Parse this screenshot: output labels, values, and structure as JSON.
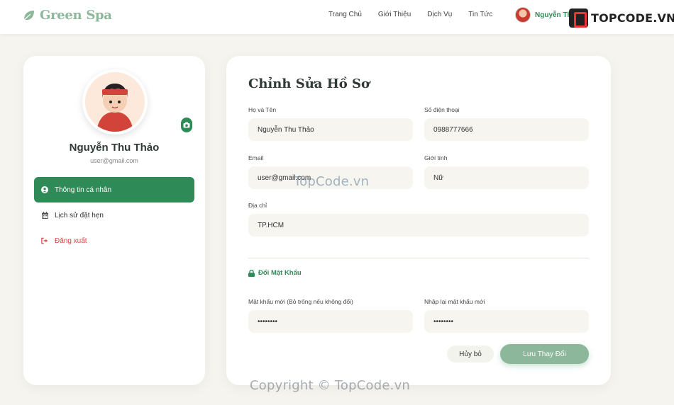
{
  "brand": {
    "name": "Green Spa",
    "leaf_color": "#8cb79a"
  },
  "nav": {
    "links": [
      "Trang Chủ",
      "Giới Thiệu",
      "Dịch Vụ",
      "Tin Tức"
    ],
    "user_name": "Nguyễn Th"
  },
  "topcode_badge": {
    "text": "TOPCODE.VN"
  },
  "profile": {
    "name": "Nguyễn Thu Thảo",
    "email": "user@gmail.com",
    "avatar_icon": "avatar-image",
    "camera_icon": "camera-icon"
  },
  "sidebar": {
    "items": [
      {
        "label": "Thông tin cá nhân",
        "icon": "user-circle-icon",
        "active": true
      },
      {
        "label": "Lịch sử đặt hẹn",
        "icon": "calendar-icon",
        "active": false
      },
      {
        "label": "Đăng xuất",
        "icon": "sign-out-icon",
        "active": false
      }
    ]
  },
  "form": {
    "title": "Chỉnh Sửa Hồ Sơ",
    "fullname": {
      "label": "Họ và Tên",
      "value": "Nguyễn Thu Thảo"
    },
    "phone": {
      "label": "Số điện thoại",
      "value": "0988777666"
    },
    "email": {
      "label": "Email",
      "value": "user@gmail.com"
    },
    "gender": {
      "label": "Giới tính",
      "value": "Nữ"
    },
    "address": {
      "label": "Địa chỉ",
      "value": "TP.HCM"
    },
    "password_section": {
      "title": "Đổi Mật Khẩu",
      "icon": "lock-icon"
    },
    "new_password": {
      "label": "Mật khẩu mới (Bỏ trống nếu không đổi)",
      "value": "••••••••"
    },
    "confirm_password": {
      "label": "Nhập lại mật khẩu mới",
      "value": "••••••••"
    },
    "cancel_label": "Hủy bỏ",
    "save_label": "Lưu Thay Đổi"
  },
  "watermarks": {
    "center": "TopCode.vn",
    "bottom": "Copyright © TopCode.vn"
  },
  "colors": {
    "primary_green": "#2e8b57",
    "soft_green": "#8cb79a",
    "danger_red": "#d64545",
    "background": "#f6f4ef"
  }
}
